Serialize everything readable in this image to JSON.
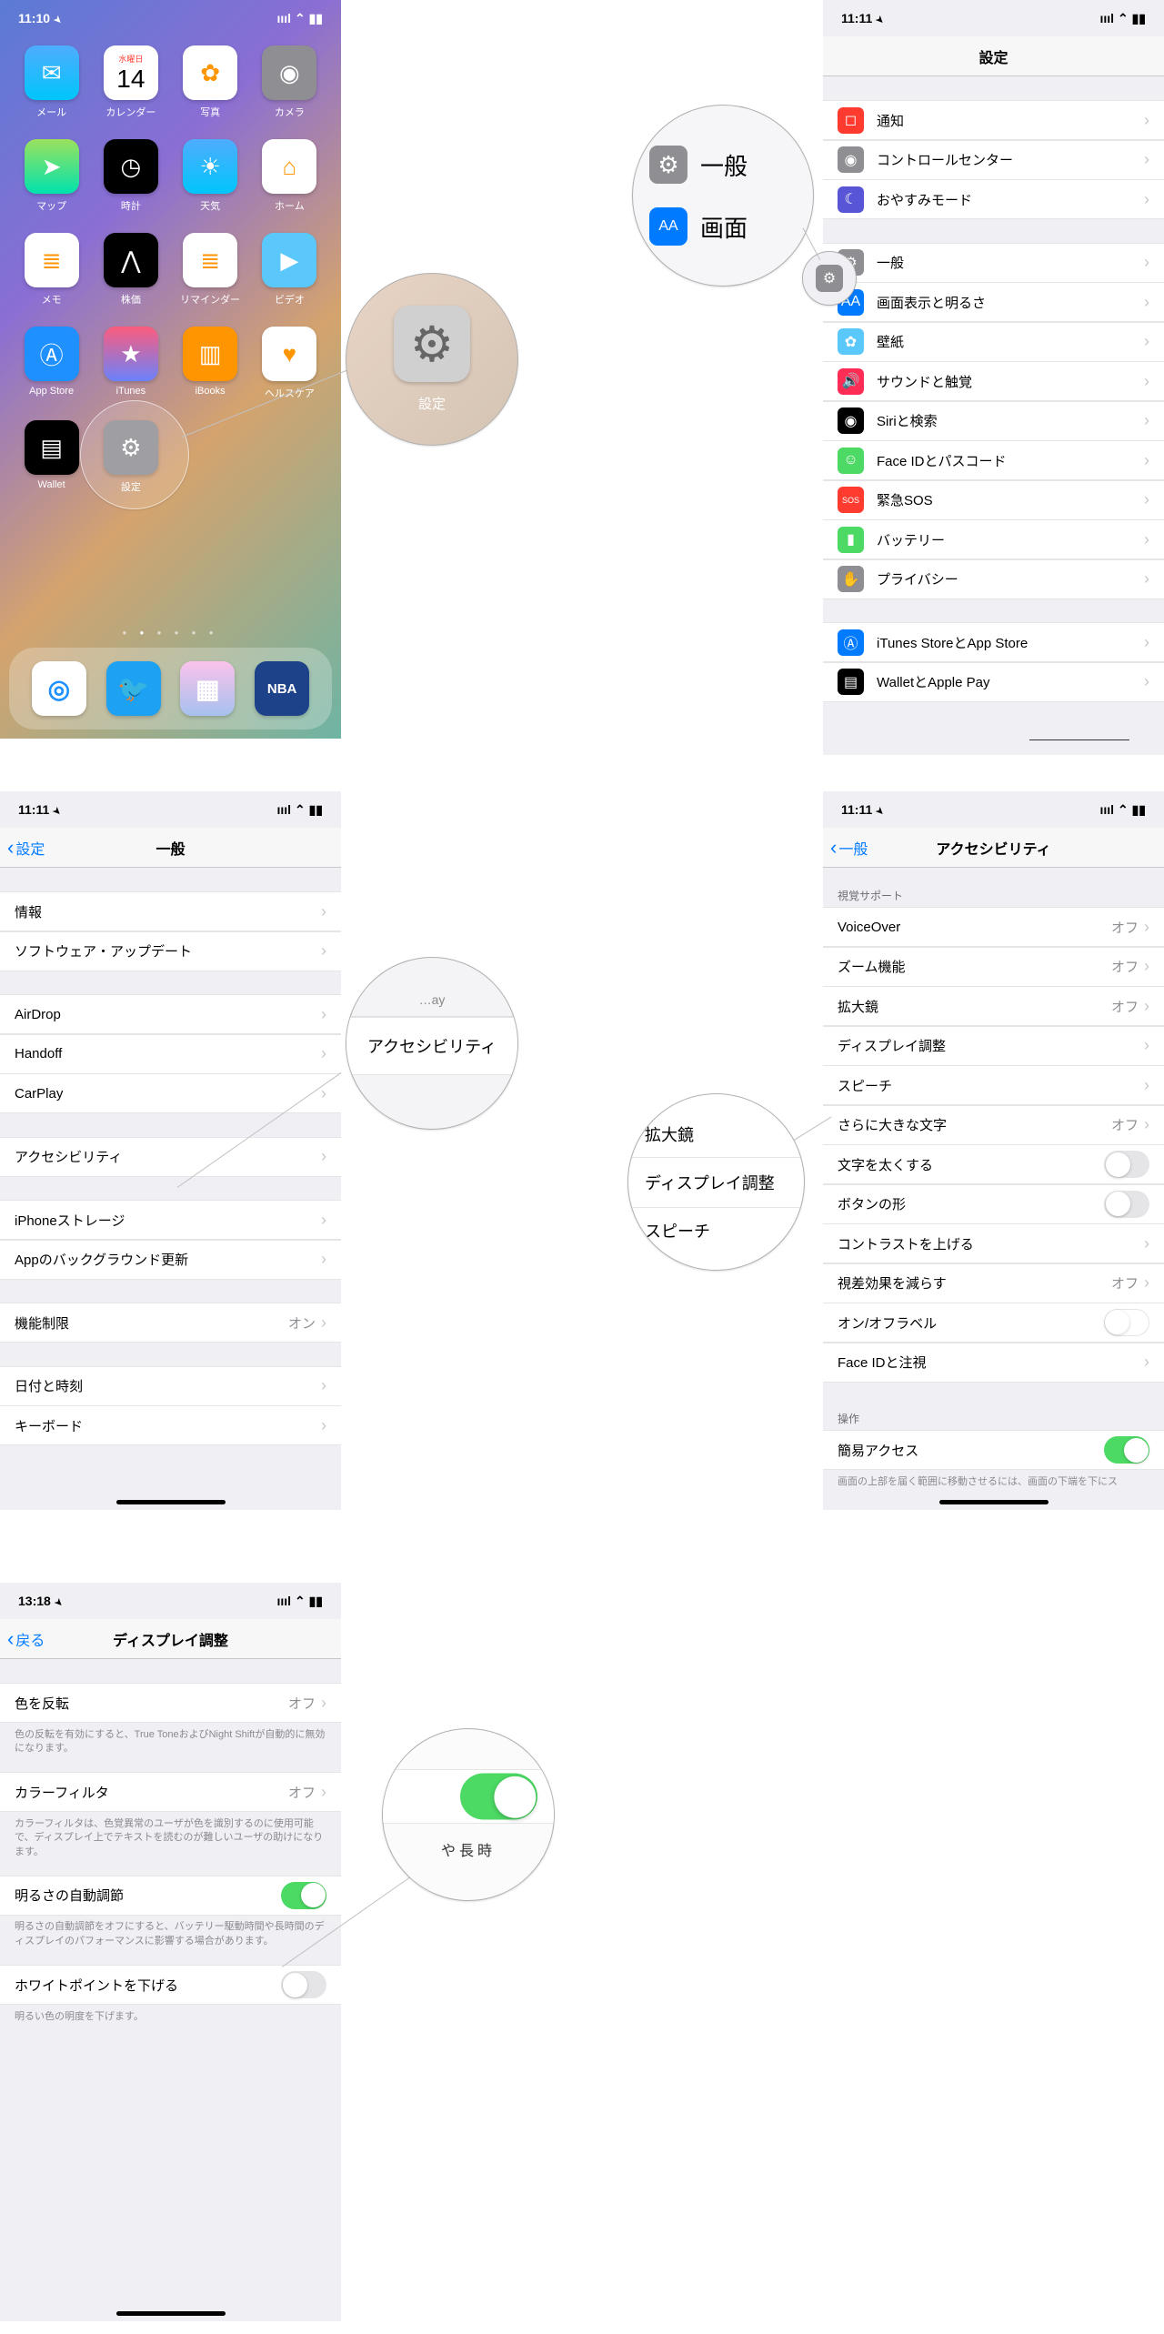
{
  "home": {
    "time": "11:10",
    "apps": [
      {
        "label": "メール",
        "color": "linear-gradient(#4facfe,#00c6fb)",
        "glyph": "✉"
      },
      {
        "label": "カレンダー",
        "color": "#fff",
        "glyph": "14",
        "textTop": "水曜日"
      },
      {
        "label": "写真",
        "color": "#fff",
        "glyph": "✿"
      },
      {
        "label": "カメラ",
        "color": "#8e8e93",
        "glyph": "◉"
      },
      {
        "label": "マップ",
        "color": "linear-gradient(#9be15d,#00e3ae)",
        "glyph": "➤"
      },
      {
        "label": "時計",
        "color": "#000",
        "glyph": "◷"
      },
      {
        "label": "天気",
        "color": "linear-gradient(#4facfe,#00c6fb)",
        "glyph": "☀"
      },
      {
        "label": "ホーム",
        "color": "#fff",
        "glyph": "⌂"
      },
      {
        "label": "メモ",
        "color": "#fff",
        "glyph": "≣"
      },
      {
        "label": "株価",
        "color": "#000",
        "glyph": "⋀"
      },
      {
        "label": "リマインダー",
        "color": "#fff",
        "glyph": "≣"
      },
      {
        "label": "ビデオ",
        "color": "#5ac8fa",
        "glyph": "▶"
      },
      {
        "label": "App Store",
        "color": "#1e90ff",
        "glyph": "Ⓐ"
      },
      {
        "label": "iTunes",
        "color": "linear-gradient(#fc5c7d,#6a82fb)",
        "glyph": "★"
      },
      {
        "label": "iBooks",
        "color": "#ff9500",
        "glyph": "▥"
      },
      {
        "label": "ヘルスケア",
        "color": "#fff",
        "glyph": "♥"
      },
      {
        "label": "Wallet",
        "color": "#000",
        "glyph": "▤"
      },
      {
        "label": "設定",
        "color": "#8e8e93",
        "glyph": "⚙"
      }
    ],
    "dock": [
      {
        "name": "safari",
        "color": "#fff",
        "glyph": "◎"
      },
      {
        "name": "twitter",
        "color": "#1da1f2",
        "glyph": "🐦"
      },
      {
        "name": "news",
        "color": "linear-gradient(#fbc2eb,#a6c1ee)",
        "glyph": "▦"
      },
      {
        "name": "nba",
        "color": "#1d428a",
        "glyph": "NBA"
      }
    ],
    "callout_label": "設定"
  },
  "settings_root": {
    "time": "11:11",
    "title": "設定",
    "rows": [
      {
        "icon": "通知",
        "color": "#ff3b30",
        "label": "通知",
        "glyph": "◻"
      },
      {
        "icon": "コントロール",
        "color": "#8e8e93",
        "label": "コントロールセンター",
        "glyph": "◉"
      },
      {
        "icon": "おやすみ",
        "color": "#5856d6",
        "label": "おやすみモード",
        "glyph": "☾"
      }
    ],
    "rows2": [
      {
        "icon": "一般",
        "color": "#8e8e93",
        "label": "一般",
        "glyph": "⚙"
      },
      {
        "icon": "display",
        "color": "#007aff",
        "label": "画面表示と明るさ",
        "glyph": "AA"
      },
      {
        "icon": "wallpaper",
        "color": "#5ac8fa",
        "label": "壁紙",
        "glyph": "✿"
      },
      {
        "icon": "sound",
        "color": "#ff2d55",
        "label": "サウンドと触覚",
        "glyph": "🔊"
      },
      {
        "icon": "siri",
        "color": "#000",
        "label": "Siriと検索",
        "glyph": "◉"
      },
      {
        "icon": "faceid",
        "color": "#4cd964",
        "label": "Face IDとパスコード",
        "glyph": "☺"
      },
      {
        "icon": "sos",
        "color": "#ff3b30",
        "label": "緊急SOS",
        "glyph": "SOS"
      },
      {
        "icon": "battery",
        "color": "#4cd964",
        "label": "バッテリー",
        "glyph": "▮"
      },
      {
        "icon": "privacy",
        "color": "#8e8e93",
        "label": "プライバシー",
        "glyph": "✋"
      }
    ],
    "rows3": [
      {
        "icon": "itunes",
        "color": "#007aff",
        "label": "iTunes StoreとApp Store",
        "glyph": "Ⓐ"
      },
      {
        "icon": "wallet",
        "color": "#000",
        "label": "WalletとApple Pay",
        "glyph": "▤"
      }
    ],
    "callout_main": "一般",
    "callout_sub": "画面"
  },
  "general": {
    "time": "11:11",
    "back": "設定",
    "title": "一般",
    "rows": [
      [
        {
          "label": "情報"
        },
        {
          "label": "ソフトウェア・アップデート"
        }
      ],
      [
        {
          "label": "AirDrop"
        },
        {
          "label": "Handoff"
        },
        {
          "label": "CarPlay"
        }
      ],
      [
        {
          "label": "アクセシビリティ"
        }
      ],
      [
        {
          "label": "iPhoneストレージ"
        },
        {
          "label": "Appのバックグラウンド更新"
        }
      ],
      [
        {
          "label": "機能制限",
          "detail": "オン"
        }
      ],
      [
        {
          "label": "日付と時刻"
        },
        {
          "label": "キーボード"
        }
      ]
    ],
    "callout": "アクセシビリティ"
  },
  "accessibility": {
    "time": "11:11",
    "back": "一般",
    "title": "アクセシビリティ",
    "section1_header": "視覚サポート",
    "rows1": [
      {
        "label": "VoiceOver",
        "detail": "オフ"
      },
      {
        "label": "ズーム機能",
        "detail": "オフ"
      },
      {
        "label": "拡大鏡",
        "detail": "オフ"
      },
      {
        "label": "ディスプレイ調整"
      },
      {
        "label": "スピーチ"
      },
      {
        "label": "さらに大きな文字",
        "detail": "オフ"
      },
      {
        "label": "文字を太くする",
        "toggle": false
      },
      {
        "label": "ボタンの形",
        "toggle": false
      },
      {
        "label": "コントラストを上げる"
      },
      {
        "label": "視差効果を減らす",
        "detail": "オフ"
      },
      {
        "label": "オン/オフラベル",
        "toggle": false,
        "outlined": true
      },
      {
        "label": "Face IDと注視"
      }
    ],
    "section2_header": "操作",
    "rows2": [
      {
        "label": "簡易アクセス",
        "toggle": true
      }
    ],
    "footer": "画面の上部を届く範囲に移動させるには、画面の下端を下にス",
    "callout": [
      "拡大鏡",
      "ディスプレイ調整",
      "スピーチ"
    ]
  },
  "display_accom": {
    "time": "13:18",
    "back": "戻る",
    "title": "ディスプレイ調整",
    "rows": [
      {
        "label": "色を反転",
        "detail": "オフ"
      }
    ],
    "footer1": "色の反転を有効にすると、True ToneおよびNight Shiftが自動的に無効になります。",
    "rows2": [
      {
        "label": "カラーフィルタ",
        "detail": "オフ"
      }
    ],
    "footer2": "カラーフィルタは、色覚異常のユーザが色を識別するのに使用可能で、ディスプレイ上でテキストを読むのが難しいユーザの助けになります。",
    "rows3": [
      {
        "label": "明るさの自動調節",
        "toggle": true
      }
    ],
    "footer3": "明るさの自動調節をオフにすると、バッテリー駆動時間や長時間のディスプレイのパフォーマンスに影響する場合があります。",
    "rows4": [
      {
        "label": "ホワイトポイントを下げる",
        "toggle": false
      }
    ],
    "footer4": "明るい色の明度を下げます。"
  }
}
